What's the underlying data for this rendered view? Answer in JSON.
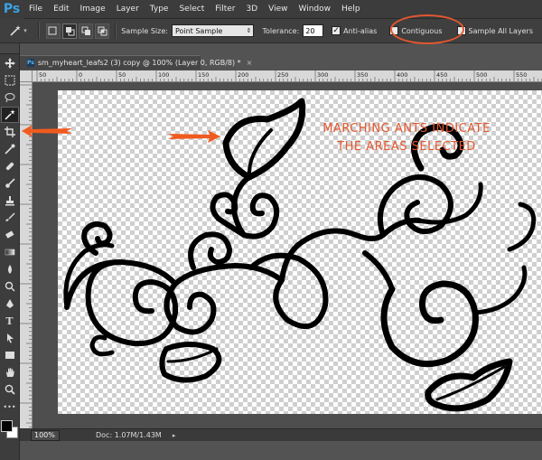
{
  "app": {
    "logo": "Ps"
  },
  "menu": [
    "File",
    "Edit",
    "Image",
    "Layer",
    "Type",
    "Select",
    "Filter",
    "3D",
    "View",
    "Window",
    "Help"
  ],
  "options": {
    "sample_size_label": "Sample Size:",
    "sample_size_value": "Point Sample",
    "tolerance_label": "Tolerance:",
    "tolerance_value": "20",
    "anti_alias_label": "Anti-alias",
    "anti_alias_checked": true,
    "contiguous_label": "Contiguous",
    "contiguous_checked": false,
    "sample_all_layers_label": "Sample All Layers",
    "sample_all_layers_checked": false
  },
  "document": {
    "tab_title": "sm_myheart_leafs2 (3) copy @ 100% (Layer 0, RGB/8) *",
    "zoom": "100%",
    "doc_size": "Doc: 1.07M/1.43M"
  },
  "ruler": {
    "ticks": [
      "50",
      "0",
      "50",
      "100",
      "150",
      "200",
      "250",
      "300",
      "350",
      "400",
      "450",
      "500",
      "550"
    ]
  },
  "annotation": {
    "line1": "MARCHING ANTS INDICATE",
    "line2": "THE AREAS SELECTED"
  },
  "colors": {
    "annotation": "#e4572e",
    "foreground": "#000000",
    "background": "#ffffff"
  },
  "tools": [
    "move-tool",
    "marquee-tool",
    "lasso-tool",
    "magic-wand-tool",
    "crop-tool",
    "eyedropper-tool",
    "spot-healing-tool",
    "brush-tool",
    "clone-stamp-tool",
    "history-brush-tool",
    "eraser-tool",
    "gradient-tool",
    "blur-tool",
    "dodge-tool",
    "pen-tool",
    "type-tool",
    "path-selection-tool",
    "rectangle-tool",
    "hand-tool",
    "zoom-tool"
  ]
}
